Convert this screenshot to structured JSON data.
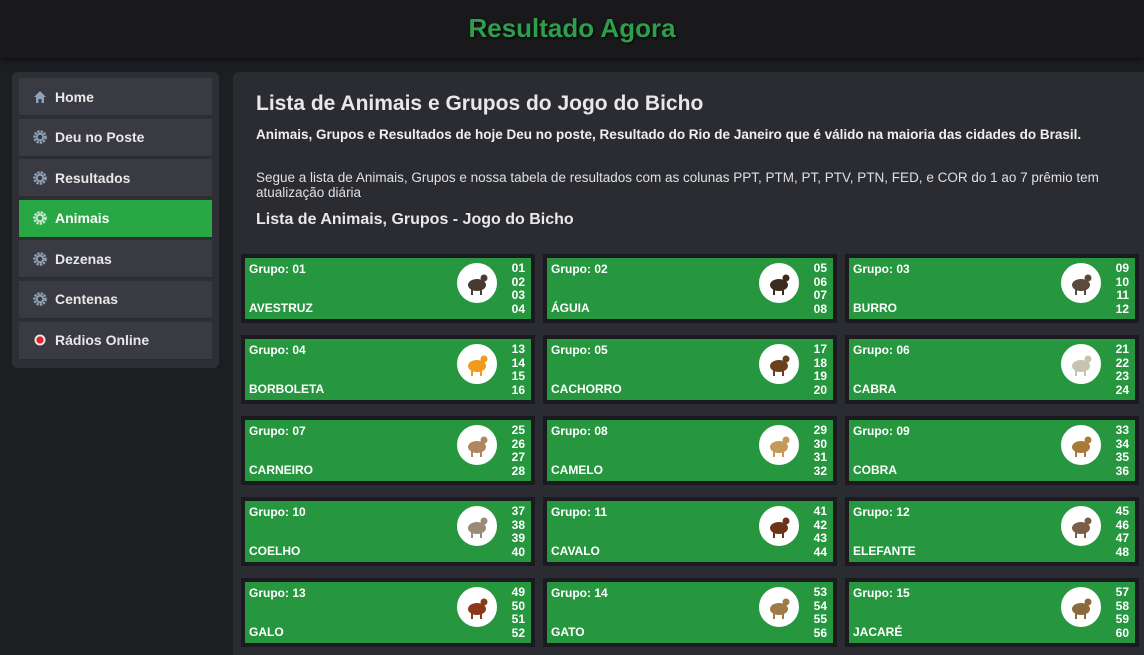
{
  "header": {
    "title": "Resultado Agora"
  },
  "sidebar": {
    "items": [
      {
        "label": "Home",
        "icon": "home-icon"
      },
      {
        "label": "Deu no Poste",
        "icon": "gear-icon"
      },
      {
        "label": "Resultados",
        "icon": "gear-icon"
      },
      {
        "label": "Animais",
        "icon": "gear-icon",
        "active": true
      },
      {
        "label": "Dezenas",
        "icon": "gear-icon"
      },
      {
        "label": "Centenas",
        "icon": "gear-icon"
      },
      {
        "label": "Rádios Online",
        "icon": "radio-icon"
      }
    ]
  },
  "main": {
    "title": "Lista de Animais e Grupos do Jogo do Bicho",
    "intro": "Animais, Grupos e Resultados de hoje Deu no poste, Resultado do Rio de Janeiro que é válido na maioria das cidades do Brasil.",
    "description": "Segue a lista de Animais, Grupos e nossa tabela de resultados com as colunas PPT, PTM, PT, PTV, PTN, FED, e COR do 1 ao 7 prêmio tem atualização diária",
    "subtitle": "Lista de Animais, Grupos - Jogo do Bicho"
  },
  "animals": [
    {
      "group": "Grupo: 01",
      "name": "AVESTRUZ",
      "numbers": [
        "01",
        "02",
        "03",
        "04"
      ],
      "icon": "ostrich-icon",
      "color": "#4a3b32"
    },
    {
      "group": "Grupo: 02",
      "name": "ÁGUIA",
      "numbers": [
        "05",
        "06",
        "07",
        "08"
      ],
      "icon": "eagle-icon",
      "color": "#3b2a1e"
    },
    {
      "group": "Grupo: 03",
      "name": "BURRO",
      "numbers": [
        "09",
        "10",
        "11",
        "12"
      ],
      "icon": "donkey-icon",
      "color": "#5a4a3c"
    },
    {
      "group": "Grupo: 04",
      "name": "BORBOLETA",
      "numbers": [
        "13",
        "14",
        "15",
        "16"
      ],
      "icon": "butterfly-icon",
      "color": "#f29a1c"
    },
    {
      "group": "Grupo: 05",
      "name": "CACHORRO",
      "numbers": [
        "17",
        "18",
        "19",
        "20"
      ],
      "icon": "dog-icon",
      "color": "#6b4020"
    },
    {
      "group": "Grupo: 06",
      "name": "CABRA",
      "numbers": [
        "21",
        "22",
        "23",
        "24"
      ],
      "icon": "goat-icon",
      "color": "#c9c2b0"
    },
    {
      "group": "Grupo: 07",
      "name": "CARNEIRO",
      "numbers": [
        "25",
        "26",
        "27",
        "28"
      ],
      "icon": "ram-icon",
      "color": "#b08660"
    },
    {
      "group": "Grupo: 08",
      "name": "CAMELO",
      "numbers": [
        "29",
        "30",
        "31",
        "32"
      ],
      "icon": "camel-icon",
      "color": "#c49a5a"
    },
    {
      "group": "Grupo: 09",
      "name": "COBRA",
      "numbers": [
        "33",
        "34",
        "35",
        "36"
      ],
      "icon": "snake-icon",
      "color": "#a87a3a"
    },
    {
      "group": "Grupo: 10",
      "name": "COELHO",
      "numbers": [
        "37",
        "38",
        "39",
        "40"
      ],
      "icon": "rabbit-icon",
      "color": "#9a8a78"
    },
    {
      "group": "Grupo: 11",
      "name": "CAVALO",
      "numbers": [
        "41",
        "42",
        "43",
        "44"
      ],
      "icon": "horse-icon",
      "color": "#6a3418"
    },
    {
      "group": "Grupo: 12",
      "name": "ELEFANTE",
      "numbers": [
        "45",
        "46",
        "47",
        "48"
      ],
      "icon": "elephant-icon",
      "color": "#7a5e48"
    },
    {
      "group": "Grupo: 13",
      "name": "GALO",
      "numbers": [
        "49",
        "50",
        "51",
        "52"
      ],
      "icon": "rooster-icon",
      "color": "#8a3a1a"
    },
    {
      "group": "Grupo: 14",
      "name": "GATO",
      "numbers": [
        "53",
        "54",
        "55",
        "56"
      ],
      "icon": "cat-icon",
      "color": "#a07a4a"
    },
    {
      "group": "Grupo: 15",
      "name": "JACARÉ",
      "numbers": [
        "57",
        "58",
        "59",
        "60"
      ],
      "icon": "alligator-icon",
      "color": "#8a6a3a"
    }
  ]
}
